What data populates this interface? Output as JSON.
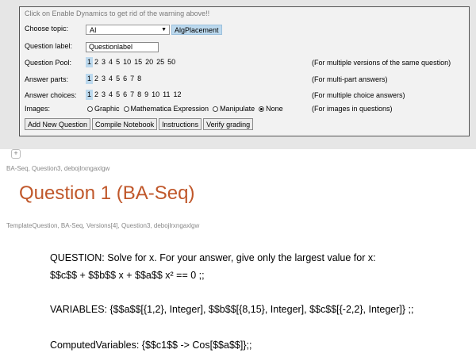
{
  "warning": "Click on Enable Dynamics to get rid of the warning above!!",
  "topic": {
    "label": "Choose topic:",
    "value": "AI",
    "button": "AlgPlacement"
  },
  "question_label": {
    "label": "Question label:",
    "value": "Questionlabel"
  },
  "pool": {
    "label": "Question Pool:",
    "options": [
      "1",
      "2",
      "3",
      "4",
      "5",
      "10",
      "15",
      "20",
      "25",
      "50"
    ],
    "selected": "1",
    "note": "(For multiple versions of the same question)"
  },
  "parts": {
    "label": "Answer parts:",
    "options": [
      "1",
      "2",
      "3",
      "4",
      "5",
      "6",
      "7",
      "8"
    ],
    "selected": "1",
    "note": "(For multi-part answers)"
  },
  "choices": {
    "label": "Answer choices:",
    "options": [
      "1",
      "2",
      "3",
      "4",
      "5",
      "6",
      "7",
      "8",
      "9",
      "10",
      "11",
      "12"
    ],
    "selected": "1",
    "note": "(For multiple choice answers)"
  },
  "images": {
    "label": "Images:",
    "options": [
      "Graphic",
      "Mathematica Expression",
      "Manipulate",
      "None"
    ],
    "selected": "None",
    "note": "(For images in questions)"
  },
  "buttons": {
    "add": "Add New Question",
    "compile": "Compile Notebook",
    "instructions": "Instructions",
    "verify": "Verify grading"
  },
  "cell_tag_1": "BA-Seq, Question3, debojlrxngaxlgw",
  "question_title": "Question 1 (BA-Seq)",
  "cell_tag_2": "TemplateQuestion, BA-Seq, Versions[4], Question3, debojlrxngaxlgw",
  "question_line": "QUESTION:  Solve for x.  For your answer, give only the largest value for x:",
  "equation_line": "$$c$$ + $$b$$ x + $$a$$ x² == 0 ;;",
  "variables_line": "VARIABLES: {$$a$$[{1,2}, Integer], $$b$$[{8,15}, Integer], $$c$$[{-2,2}, Integer]} ;;",
  "computed_line": "ComputedVariables: {$$c1$$ -> Cos[$$a$$]};;"
}
